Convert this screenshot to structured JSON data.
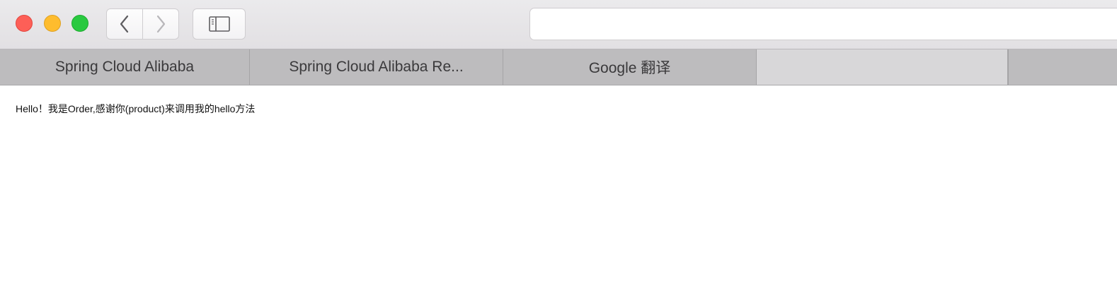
{
  "window": {
    "traffic_lights": {
      "close_color": "#fd5f57",
      "minimize_color": "#febc2e",
      "maximize_color": "#29c940"
    }
  },
  "toolbar": {
    "back_icon": "chevron-left-icon",
    "forward_icon": "chevron-right-icon",
    "sidebar_icon": "sidebar-icon",
    "address_value": ""
  },
  "tabs": [
    {
      "label": "Spring Cloud Alibaba",
      "active": false
    },
    {
      "label": "Spring Cloud Alibaba Re...",
      "active": false
    },
    {
      "label": "Google 翻译",
      "active": false
    },
    {
      "label": "",
      "active": true
    },
    {
      "label": "",
      "active": false
    }
  ],
  "page": {
    "body_text": "Hello！我是Order,感谢你(product)来调用我的hello方法"
  }
}
